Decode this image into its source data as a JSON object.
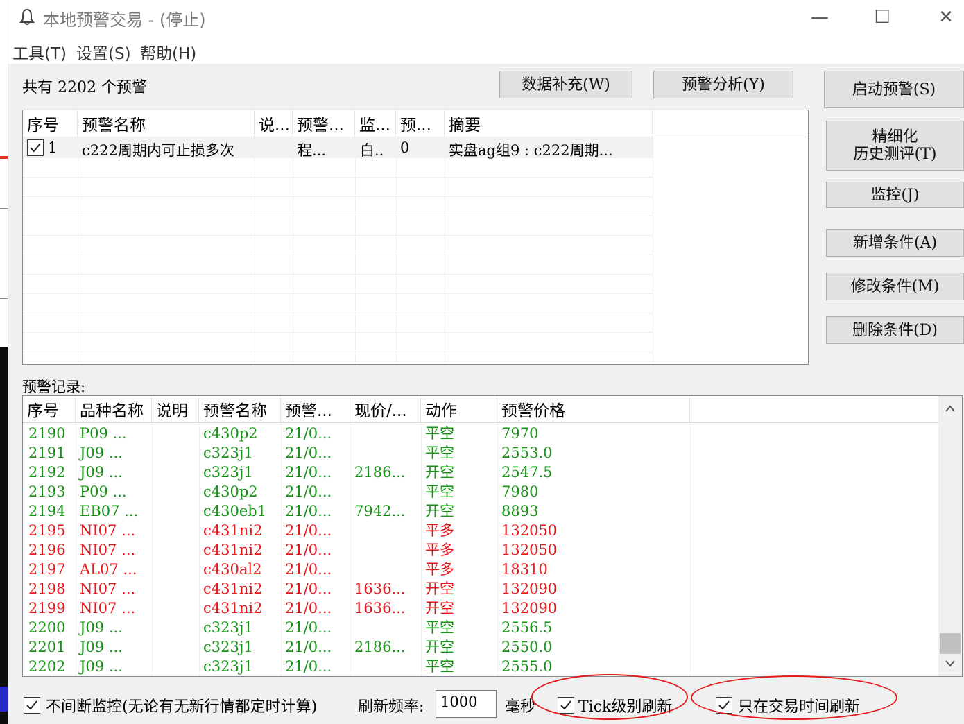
{
  "window": {
    "title": "本地预警交易 - (停止)",
    "minimize": "—",
    "maximize": "☐",
    "close": "✕"
  },
  "menu": [
    "工具(T)",
    "设置(S)",
    "帮助(H)"
  ],
  "summary": {
    "text": "共有 2202 个预警"
  },
  "buttons": {
    "data_fill": "数据补充(W)",
    "alert_analysis": "预警分析(Y)",
    "start_alert": "启动预警(S)",
    "refine_line1": "精细化",
    "refine_line2": "历史测评(T)",
    "monitor": "监控(J)",
    "add_condition": "新增条件(A)",
    "modify_condition": "修改条件(M)",
    "delete_condition": "删除条件(D)"
  },
  "alerts_table": {
    "headers": [
      "序号",
      "预警名称",
      "说...",
      "预警...",
      "监...",
      "预...",
      "摘要"
    ],
    "rows": [
      {
        "checked": true,
        "no": "1",
        "name": "c222周期内可止损多次",
        "desc": "",
        "type": "程...",
        "monitor": "白..",
        "count": "0",
        "summary": "实盘ag组9 : c222周期..."
      }
    ]
  },
  "records_label": "预警记录:",
  "records_table": {
    "headers": [
      "序号",
      "品种名称",
      "说明",
      "预警名称",
      "预警...",
      "现价/...",
      "动作",
      "预警价格"
    ],
    "rows": [
      {
        "color": "green",
        "no": "2190",
        "product": "P09 ...",
        "desc": "",
        "alert": "c430p2",
        "time": "21/0...",
        "price_now": "",
        "action": "平空",
        "alert_price": "7970"
      },
      {
        "color": "green",
        "no": "2191",
        "product": "J09 ...",
        "desc": "",
        "alert": "c323j1",
        "time": "21/0...",
        "price_now": "",
        "action": "平空",
        "alert_price": "2553.0"
      },
      {
        "color": "green",
        "no": "2192",
        "product": "J09 ...",
        "desc": "",
        "alert": "c323j1",
        "time": "21/0...",
        "price_now": "2186...",
        "action": "开空",
        "alert_price": "2547.5"
      },
      {
        "color": "green",
        "no": "2193",
        "product": "P09 ...",
        "desc": "",
        "alert": "c430p2",
        "time": "21/0...",
        "price_now": "",
        "action": "平空",
        "alert_price": "7980"
      },
      {
        "color": "green",
        "no": "2194",
        "product": "EB07 ...",
        "desc": "",
        "alert": "c430eb1",
        "time": "21/0...",
        "price_now": "7942...",
        "action": "开空",
        "alert_price": "8893"
      },
      {
        "color": "red",
        "no": "2195",
        "product": "NI07 ...",
        "desc": "",
        "alert": "c431ni2",
        "time": "21/0...",
        "price_now": "",
        "action": "平多",
        "alert_price": "132050"
      },
      {
        "color": "red",
        "no": "2196",
        "product": "NI07 ...",
        "desc": "",
        "alert": "c431ni2",
        "time": "21/0...",
        "price_now": "",
        "action": "平多",
        "alert_price": "132050"
      },
      {
        "color": "red",
        "no": "2197",
        "product": "AL07 ...",
        "desc": "",
        "alert": "c430al2",
        "time": "21/0...",
        "price_now": "",
        "action": "平多",
        "alert_price": "18310"
      },
      {
        "color": "red",
        "no": "2198",
        "product": "NI07 ...",
        "desc": "",
        "alert": "c431ni2",
        "time": "21/0...",
        "price_now": "1636...",
        "action": "开空",
        "alert_price": "132090"
      },
      {
        "color": "red",
        "no": "2199",
        "product": "NI07 ...",
        "desc": "",
        "alert": "c431ni2",
        "time": "21/0...",
        "price_now": "1636...",
        "action": "开空",
        "alert_price": "132090"
      },
      {
        "color": "green",
        "no": "2200",
        "product": "J09 ...",
        "desc": "",
        "alert": "c323j1",
        "time": "21/0...",
        "price_now": "",
        "action": "平空",
        "alert_price": "2556.5"
      },
      {
        "color": "green",
        "no": "2201",
        "product": "J09 ...",
        "desc": "",
        "alert": "c323j1",
        "time": "21/0...",
        "price_now": "2186...",
        "action": "开空",
        "alert_price": "2550.0"
      },
      {
        "color": "green",
        "no": "2202",
        "product": "J09 ...",
        "desc": "",
        "alert": "c323j1",
        "time": "21/0...",
        "price_now": "",
        "action": "平空",
        "alert_price": "2555.0"
      }
    ]
  },
  "bottom": {
    "continuous_monitor_label": "不间断监控(无论有无新行情都定时计算)",
    "continuous_monitor_checked": true,
    "refresh_rate_label": "刷新频率:",
    "refresh_rate_value": "1000",
    "refresh_unit": "毫秒",
    "tick_refresh_label": "Tick级别刷新",
    "tick_refresh_checked": true,
    "trading_time_label": "只在交易时间刷新",
    "trading_time_checked": true
  },
  "colors": {
    "buy_green": "#159315",
    "sell_red": "#e8161a",
    "annotation_red": "#e41a1a"
  },
  "icons": {
    "title": "bell-icon",
    "check": "checkmark-icon",
    "scroll_up": "chevron-up-icon",
    "scroll_down": "chevron-down-icon"
  }
}
